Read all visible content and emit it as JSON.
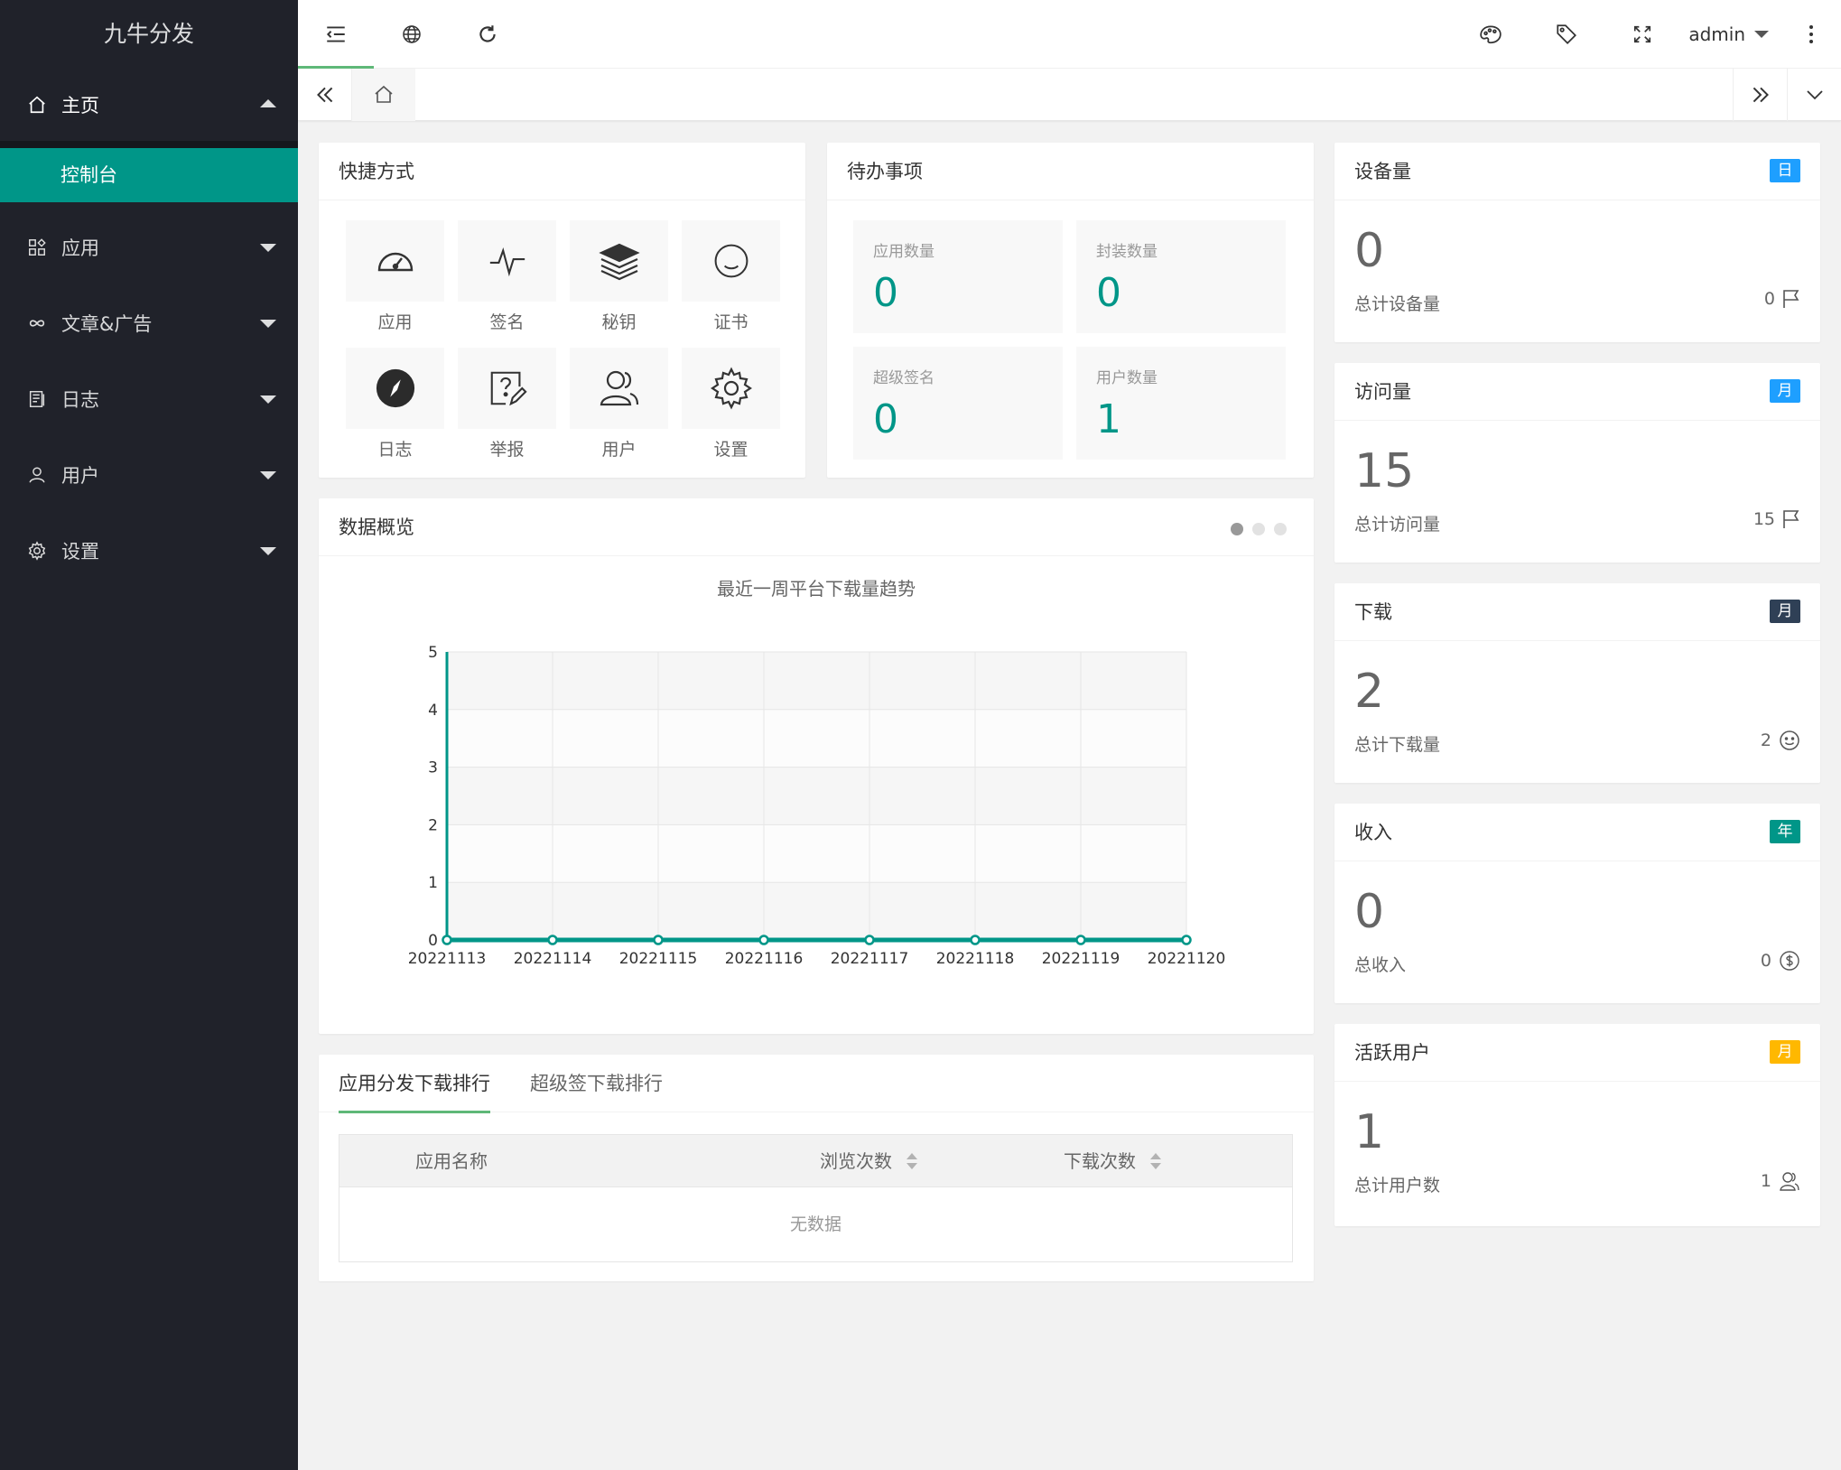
{
  "app": {
    "title": "九牛分发"
  },
  "sidebar": {
    "home": {
      "label": "主页",
      "sub": "控制台"
    },
    "items": [
      {
        "label": "应用",
        "icon": "apps-icon"
      },
      {
        "label": "文章&广告",
        "icon": "link-icon"
      },
      {
        "label": "日志",
        "icon": "log-icon"
      },
      {
        "label": "用户",
        "icon": "user-icon"
      },
      {
        "label": "设置",
        "icon": "gear-icon"
      }
    ]
  },
  "header": {
    "user": "admin"
  },
  "shortcuts": {
    "title": "快捷方式",
    "items": [
      {
        "label": "应用",
        "icon": "dashboard-icon"
      },
      {
        "label": "签名",
        "icon": "pulse-icon"
      },
      {
        "label": "秘钥",
        "icon": "layers-icon"
      },
      {
        "label": "证书",
        "icon": "smile-icon"
      },
      {
        "label": "日志",
        "icon": "compass-icon"
      },
      {
        "label": "举报",
        "icon": "report-icon"
      },
      {
        "label": "用户",
        "icon": "users-icon"
      },
      {
        "label": "设置",
        "icon": "settings-icon"
      }
    ]
  },
  "todo": {
    "title": "待办事项",
    "items": [
      {
        "label": "应用数量",
        "value": "0"
      },
      {
        "label": "封装数量",
        "value": "0"
      },
      {
        "label": "超级签名",
        "value": "0"
      },
      {
        "label": "用户数量",
        "value": "1"
      }
    ]
  },
  "stats": [
    {
      "title": "设备量",
      "badge": "日",
      "badge_color": "#1e9fff",
      "value": "0",
      "footer": "总计设备量",
      "right_value": "0",
      "icon": "flag-icon"
    },
    {
      "title": "访问量",
      "badge": "月",
      "badge_color": "#1e9fff",
      "value": "15",
      "footer": "总计访问量",
      "right_value": "15",
      "icon": "flag-icon"
    },
    {
      "title": "下载",
      "badge": "月",
      "badge_color": "#2f4056",
      "value": "2",
      "footer": "总计下载量",
      "right_value": "2",
      "icon": "smile-icon"
    },
    {
      "title": "收入",
      "badge": "年",
      "badge_color": "#009688",
      "value": "0",
      "footer": "总收入",
      "right_value": "0",
      "icon": "dollar-icon"
    },
    {
      "title": "活跃用户",
      "badge": "月",
      "badge_color": "#ffb800",
      "value": "1",
      "footer": "总计用户数",
      "right_value": "1",
      "icon": "user-icon"
    }
  ],
  "overview": {
    "title": "数据概览"
  },
  "chart_data": {
    "type": "line",
    "title": "最近一周平台下载量趋势",
    "categories": [
      "20221113",
      "20221114",
      "20221115",
      "20221116",
      "20221117",
      "20221118",
      "20221119",
      "20221120"
    ],
    "values": [
      0,
      0,
      0,
      0,
      0,
      0,
      0,
      0
    ],
    "ylim": [
      0,
      5
    ],
    "yticks": [
      "0",
      "1",
      "2",
      "3",
      "4",
      "5"
    ],
    "color": "#009688",
    "grid": true
  },
  "ranking": {
    "tabs": [
      "应用分发下载排行",
      "超级签下载排行"
    ],
    "columns": [
      "应用名称",
      "浏览次数",
      "下载次数"
    ],
    "empty": "无数据"
  }
}
